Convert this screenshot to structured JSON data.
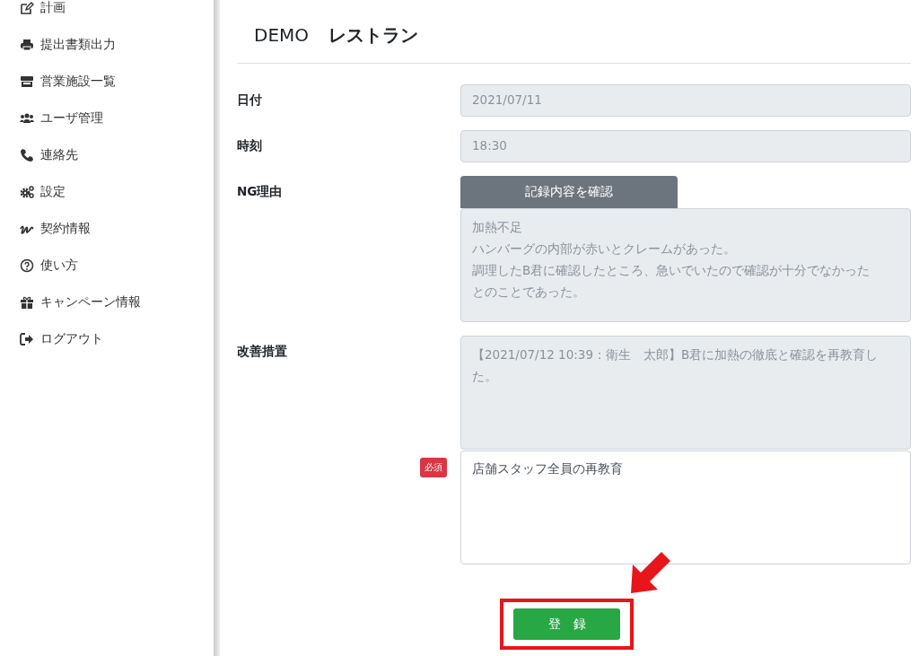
{
  "sidebar": {
    "items": [
      {
        "label": "計画"
      },
      {
        "label": "提出書類出力"
      },
      {
        "label": "営業施設一覧"
      },
      {
        "label": "ユーザ管理"
      },
      {
        "label": "連絡先"
      },
      {
        "label": "設定"
      },
      {
        "label": "契約情報"
      },
      {
        "label": "使い方"
      },
      {
        "label": "キャンペーン情報"
      },
      {
        "label": "ログアウト"
      }
    ]
  },
  "header": {
    "company": "DEMO",
    "store": "レストラン"
  },
  "form": [
    {
      "kind": "field",
      "label": "日付",
      "value": "2021/07/11",
      "disabled": true
    },
    {
      "kind": "field",
      "label": "時刻",
      "value": "18:30",
      "disabled": true
    },
    {
      "kind": "record",
      "label": "NG理由",
      "button": "記録内容を確認",
      "disabled": true,
      "lines": [
        "加熱不足",
        "ハンバーグの内部が赤いとクレームがあった。",
        "調理したB君に確認したところ、急いでいたので確認が十分でなかった",
        "とのことであった。"
      ]
    },
    {
      "kind": "history",
      "label": "改善措置",
      "value": "【2021/07/12 10:39：衛生　太郎】B君に加熱の徹底と確認を再教育した。",
      "disabled": true
    },
    {
      "kind": "input",
      "badge": "必須",
      "value": "店舗スタッフ全員の再教育",
      "disabled": false
    }
  ],
  "submit": {
    "label": "登　録",
    "highlighted": true
  }
}
